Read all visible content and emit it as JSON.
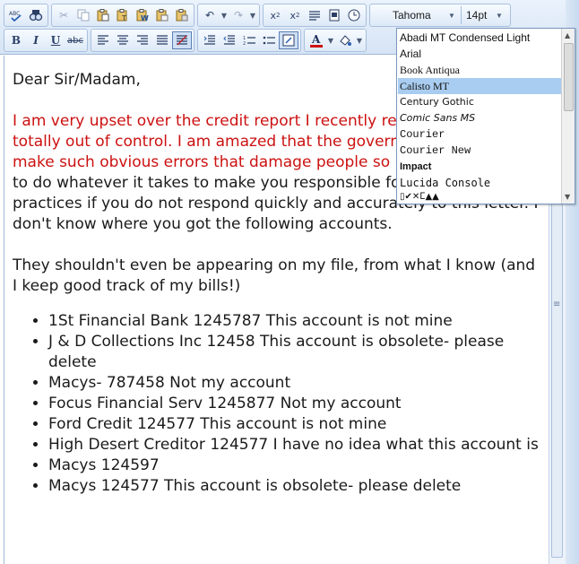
{
  "toolbar": {
    "font_name": "Tahoma",
    "font_size": "14pt"
  },
  "font_menu": {
    "items": [
      "Abadi MT Condensed Light",
      "Arial",
      "Book Antiqua",
      "Calisto MT",
      "Century Gothic",
      "Comic Sans MS",
      "Courier",
      "Courier New",
      "Impact",
      "Lucida Console",
      "▯✔✕ⵎ▲▲"
    ],
    "selected": "Calisto MT"
  },
  "document": {
    "greeting": "Dear Sir/Madam,",
    "red_lines": [
      "I am very upset over the credit report I recently rec",
      "totally out of control. I am amazed that the governm",
      "make such obvious errors that damage people so b"
    ],
    "body_lines": [
      "to do whatever it takes to make you responsible for",
      "practices if you do not respond quickly and accurately to this letter. I",
      "don't know where you got the following accounts."
    ],
    "para2_lines": [
      "They shouldn't even be appearing on my file, from what I know (and",
      "I keep good track of my bills!)"
    ],
    "accounts": [
      "1St Financial Bank 1245787 This account is not mine",
      "J & D Collections Inc  12458 This account is obsolete- please delete",
      "Macys-  787458 Not my account",
      "Focus Financial Serv 1245877 Not my account",
      "Ford Credit 124577 This account is not mine",
      "High Desert Creditor 124577 I have no idea what this account is",
      "Macys 124597",
      "Macys 124577 This account is obsolete- please delete"
    ]
  },
  "colors": {
    "emphasis_text": "#cc1111",
    "selection_highlight": "#a9cdf0",
    "toolbar_border": "#a9c0de"
  }
}
